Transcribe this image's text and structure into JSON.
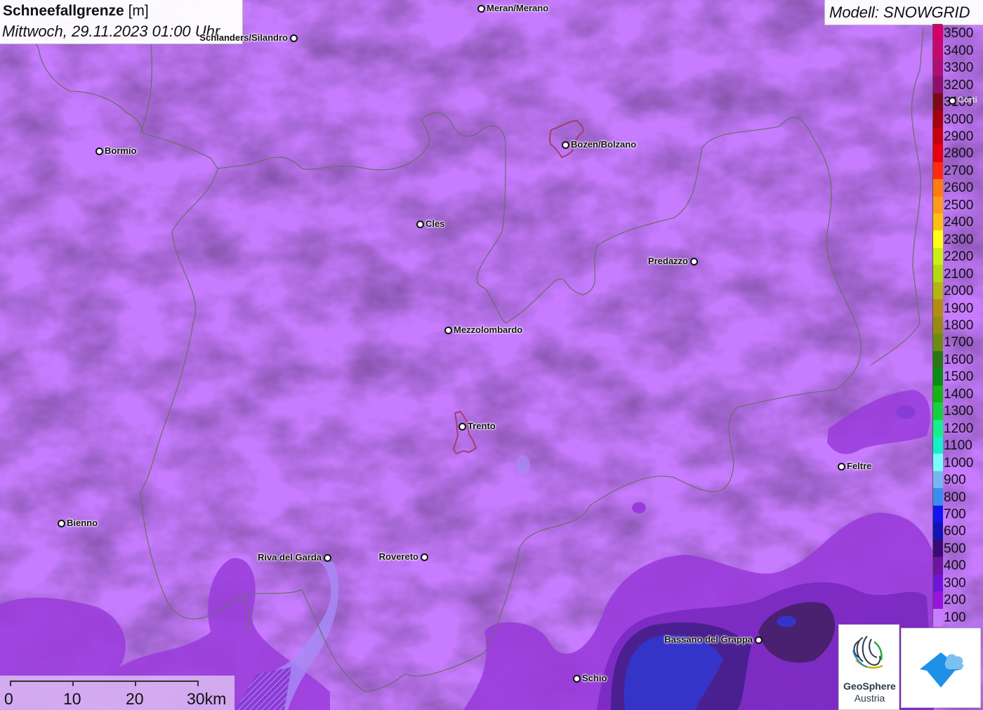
{
  "header": {
    "title_bold": "Schneefallgrenze",
    "title_unit": "[m]",
    "datetime": "Mittwoch, 29.11.2023 01:00 Uhr"
  },
  "model": {
    "label": "Modell: SNOWGRID"
  },
  "legend": {
    "entries": [
      {
        "label": "3500",
        "color": "#d4006a"
      },
      {
        "label": "3400",
        "color": "#c40a6e"
      },
      {
        "label": "3300",
        "color": "#b00f76"
      },
      {
        "label": "3200",
        "color": "#8f0f6e"
      },
      {
        "label": "3100",
        "color": "#7a0a1a"
      },
      {
        "label": "3000",
        "color": "#a80010"
      },
      {
        "label": "2900",
        "color": "#c80010"
      },
      {
        "label": "2800",
        "color": "#e60012"
      },
      {
        "label": "2700",
        "color": "#ff2a10"
      },
      {
        "label": "2600",
        "color": "#ff7a10"
      },
      {
        "label": "2500",
        "color": "#ff9a1a"
      },
      {
        "label": "2400",
        "color": "#ffbe14"
      },
      {
        "label": "2300",
        "color": "#ffff14"
      },
      {
        "label": "2200",
        "color": "#c8f014"
      },
      {
        "label": "2100",
        "color": "#b4d814"
      },
      {
        "label": "2000",
        "color": "#b4b414"
      },
      {
        "label": "1900",
        "color": "#b48c14"
      },
      {
        "label": "1800",
        "color": "#968c14"
      },
      {
        "label": "1700",
        "color": "#6e8c14"
      },
      {
        "label": "1600",
        "color": "#287814"
      },
      {
        "label": "1500",
        "color": "#0a8c14"
      },
      {
        "label": "1400",
        "color": "#14b414"
      },
      {
        "label": "1300",
        "color": "#14d23c"
      },
      {
        "label": "1200",
        "color": "#14f08c"
      },
      {
        "label": "1100",
        "color": "#14f0c8"
      },
      {
        "label": "1000",
        "color": "#7afcfc"
      },
      {
        "label": "900",
        "color": "#78b4f0"
      },
      {
        "label": "800",
        "color": "#3c8cf0"
      },
      {
        "label": "700",
        "color": "#1414f0"
      },
      {
        "label": "600",
        "color": "#1414b4"
      },
      {
        "label": "500",
        "color": "#3c0a78"
      },
      {
        "label": "400",
        "color": "#6e14a0"
      },
      {
        "label": "300",
        "color": "#6e14dc"
      },
      {
        "label": "200",
        "color": "#9614dc"
      },
      {
        "label": "100",
        "color": "#c87cff"
      }
    ]
  },
  "cities": [
    {
      "name": "Meran/Merano",
      "label_side": "right"
    },
    {
      "name": "Schlanders/Silandro",
      "label_side": "left"
    },
    {
      "name": "Bozen/Bolzano",
      "label_side": "right"
    },
    {
      "name": "Bormio",
      "label_side": "right"
    },
    {
      "name": "Cles",
      "label_side": "right"
    },
    {
      "name": "Predazzo",
      "label_side": "left"
    },
    {
      "name": "Mezzolombardo",
      "label_side": "right"
    },
    {
      "name": "Trento",
      "label_side": "right"
    },
    {
      "name": "Feltre",
      "label_side": "right"
    },
    {
      "name": "Bienno",
      "label_side": "right"
    },
    {
      "name": "Riva del Garda",
      "label_side": "left"
    },
    {
      "name": "Rovereto",
      "label_side": "left"
    },
    {
      "name": "Bassano del Grappa",
      "label_side": "left"
    },
    {
      "name": "Schio",
      "label_side": "right"
    },
    {
      "name": "Corti",
      "label_side": "right"
    }
  ],
  "scale": {
    "labels": [
      "0",
      "10",
      "20",
      "30km"
    ]
  },
  "logos": {
    "geosphere_name": "GeoSphere",
    "geosphere_sub": "Austria",
    "app_icon": "cloud-house-icon"
  }
}
